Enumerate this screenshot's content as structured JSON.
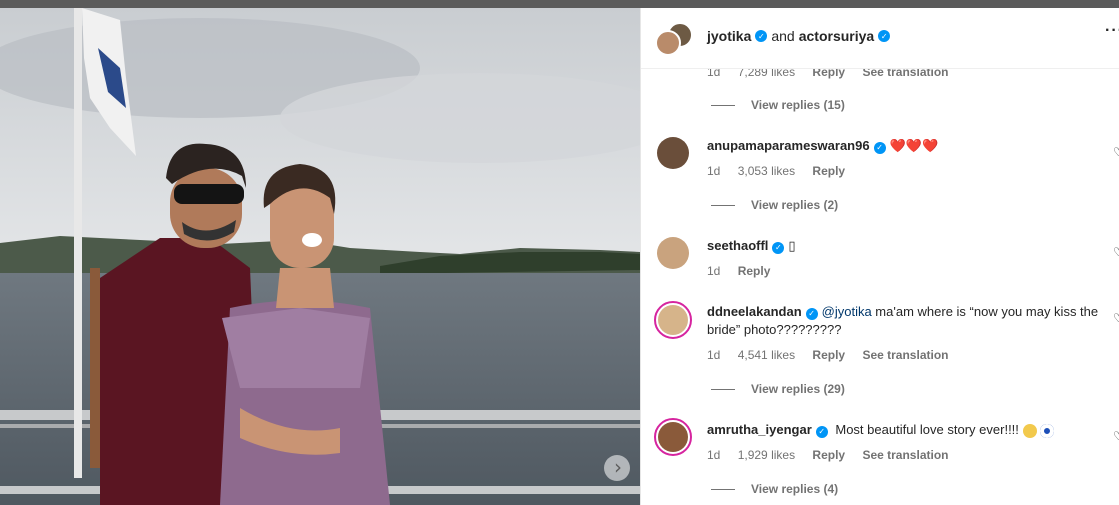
{
  "header": {
    "user1": "jyotika",
    "connector": "and",
    "user2": "actorsuriya",
    "more_icon": "more-horizontal-icon"
  },
  "partial": {
    "time": "1d",
    "likes": "7,289 likes",
    "reply": "Reply",
    "translate": "See translation",
    "view_replies": "View replies (15)"
  },
  "comments": [
    {
      "username": "anupamaparameswaran96",
      "text": "",
      "emojis": "❤️❤️❤️",
      "time": "1d",
      "likes": "3,053 likes",
      "reply": "Reply",
      "view_replies": "View replies (2)"
    },
    {
      "username": "seethaoffl",
      "text": "",
      "emojis": "▯",
      "time": "1d",
      "reply": "Reply"
    },
    {
      "username": "ddneelakandan",
      "mention": "@jyotika",
      "text": " ma'am where is “now you may kiss the bride” photo?????????",
      "time": "1d",
      "likes": "4,541 likes",
      "reply": "Reply",
      "translate": "See translation",
      "view_replies": "View replies (29)"
    },
    {
      "username": "amrutha_iyengar",
      "text": " Most beautiful love story ever!!!! ",
      "time": "1d",
      "likes": "1,929 likes",
      "reply": "Reply",
      "translate": "See translation",
      "view_replies": "View replies (4)"
    }
  ],
  "colors": {
    "verified": "#0095f6",
    "story_ring": "#d6249f",
    "text": "#262626",
    "muted": "#737373"
  }
}
